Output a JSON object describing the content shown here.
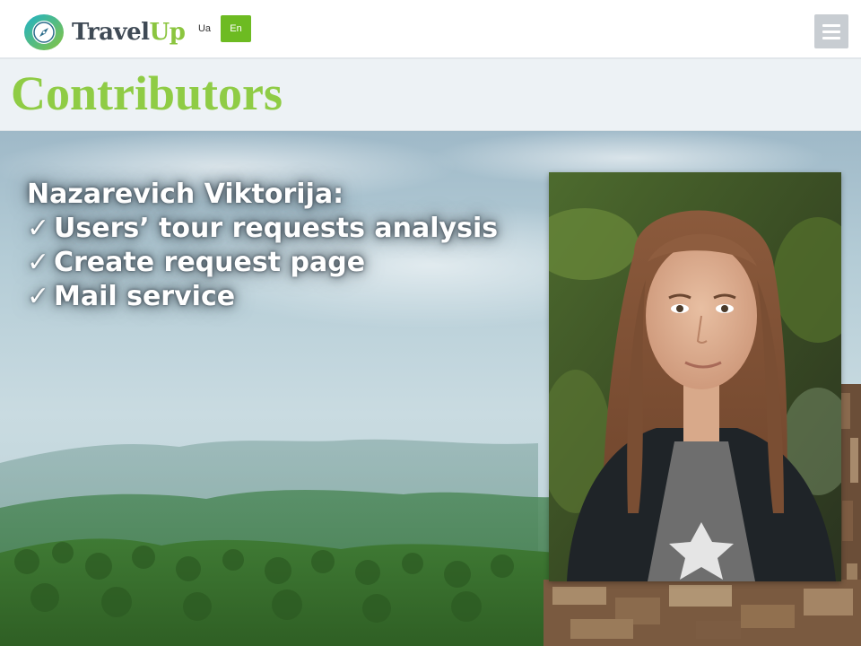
{
  "header": {
    "logo": {
      "part1": "Travel",
      "part2": "Up",
      "icon": "compass-icon"
    },
    "languages": [
      {
        "label": "Ua",
        "active": false
      },
      {
        "label": "En",
        "active": true
      }
    ],
    "menu_icon": "hamburger-menu-icon"
  },
  "page": {
    "title": "Contributors"
  },
  "contributor": {
    "name": "Nazarevich Viktorija:",
    "check_glyph": "✓",
    "tasks": [
      "Users’ tour requests analysis",
      "Create request page",
      "Mail service"
    ]
  },
  "colors": {
    "brand_green": "#8bc53f",
    "title_green": "#8fcc45",
    "active_lang_bg": "#6dbb22",
    "menu_button_bg": "#c8cdd2",
    "title_band_bg": "#edf2f5"
  }
}
